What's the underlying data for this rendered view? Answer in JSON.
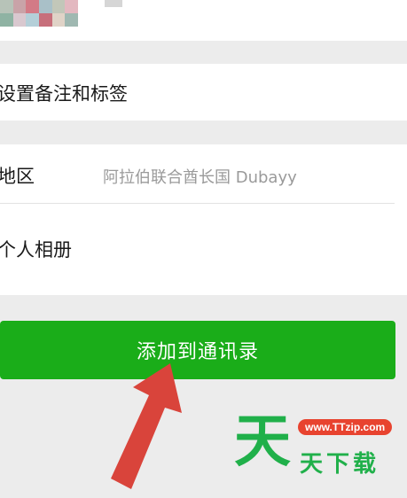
{
  "profile": {
    "avatar_colors": [
      "#b7c3b8",
      "#c9a3a8",
      "#d37a86",
      "#a9c0c8",
      "#c2c7b9",
      "#e3b8c0",
      "#8fb3a3",
      "#d9c8cf",
      "#b4cfd8",
      "#c76f7b",
      "#e0d3c7",
      "#9fb8b1"
    ]
  },
  "rows": {
    "remarks": {
      "label": "设置备注和标签"
    },
    "region": {
      "label": "地区",
      "value": "阿拉伯联合酋长国  Dubayy"
    },
    "album": {
      "label": "个人相册"
    }
  },
  "actions": {
    "add_contact_label": "添加到通讯录"
  },
  "watermark": {
    "big_char": "天",
    "url": "www.TTzip.com",
    "text": "天下载"
  },
  "colors": {
    "accent_green": "#1aad19",
    "arrow_red": "#d9443b",
    "watermark_green": "#20b04a",
    "watermark_red": "#e8432f"
  }
}
